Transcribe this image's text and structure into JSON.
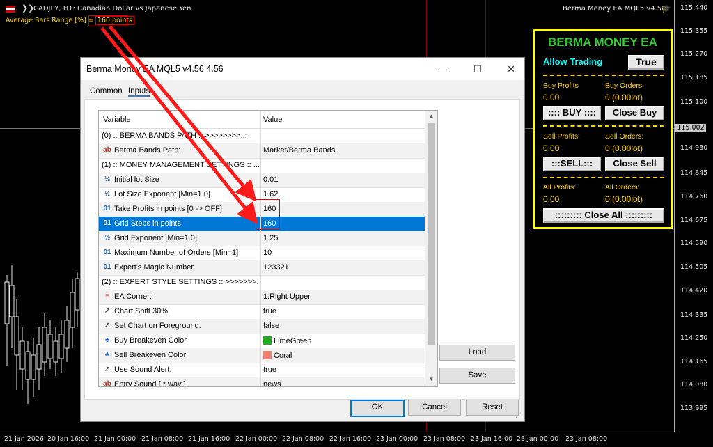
{
  "chart": {
    "symbol_title": "CADJPY, H1:  Canadian Dollar vs Japanese Yen",
    "avg_label": "Average Bars Range [%] =",
    "avg_value": "160 points",
    "ea_label": "Berma Money EA MQL5 v4.56",
    "current_price": "115.002",
    "price_labels": [
      "115.440",
      "115.355",
      "115.270",
      "115.185",
      "115.100",
      "114.930",
      "114.845",
      "114.760",
      "114.675",
      "114.590",
      "114.505",
      "114.420",
      "114.335",
      "114.250",
      "114.165",
      "114.080",
      "113.995"
    ],
    "time_labels": [
      "21 Jan 2026",
      "20 Jan 16:00",
      "21 Jan 00:00",
      "21 Jan 08:00",
      "21 Jan 16:00",
      "22 Jan 00:00",
      "22 Jan 08:00",
      "22 Jan 16:00",
      "23 Jan 00:00",
      "23 Jan 08:00",
      "23 Jan 16:00",
      "23 Jan 00:00",
      "23 Jan 08:00"
    ]
  },
  "panel": {
    "title": "BERMA MONEY EA",
    "allow_label": "Allow Trading",
    "allow_value": "True",
    "buy_profits_label": "Buy Profits",
    "buy_profits_value": "0.00",
    "buy_orders_label": "Buy Orders:",
    "buy_orders_value": "0 (0.00lot)",
    "buy_btn": ":::: BUY ::::",
    "close_buy_btn": "Close Buy",
    "sell_profits_label": "Sell Profits:",
    "sell_profits_value": "0.00",
    "sell_orders_label": "Sell Orders:",
    "sell_orders_value": "0 (0.00lot)",
    "sell_btn": ":::SELL:::",
    "close_sell_btn": "Close Sell",
    "all_profits_label": "All Profits:",
    "all_profits_value": "0.00",
    "all_orders_label": "All Orders:",
    "all_orders_value": "0 (0.00lot)",
    "close_all_btn": "::::::::: Close All :::::::::"
  },
  "dialog": {
    "title": "Berma Money EA MQL5 v4.56 4.56",
    "minimize": "—",
    "maximize": "☐",
    "close": "✕",
    "tabs": [
      "Common",
      "Inputs"
    ],
    "col_variable": "Variable",
    "col_value": "Value",
    "rows": [
      {
        "icon": "",
        "name": "(0) :: BERMA BANDS PATH :: >>>>>>>>...",
        "value": ""
      },
      {
        "icon": "ab",
        "name": "Berma Bands Path:",
        "value": "Market/Berma Bands"
      },
      {
        "icon": "",
        "name": "(1) :: MONEY MANAGEMENT SETTINGS :: ...",
        "value": ""
      },
      {
        "icon": "½",
        "name": "Initial lot Size",
        "value": "0.01"
      },
      {
        "icon": "½",
        "name": "Lot Size Exponent [Min=1.0]",
        "value": "1.62"
      },
      {
        "icon": "01",
        "name": "Take Profits in points [0 -> OFF]",
        "value": "160"
      },
      {
        "icon": "01",
        "name": "Grid Steps in points",
        "value": "160"
      },
      {
        "icon": "½",
        "name": "Grid Exponent [Min=1.0]",
        "value": "1.25"
      },
      {
        "icon": "01",
        "name": "Maximum Number of Orders [Min=1]",
        "value": "10"
      },
      {
        "icon": "01",
        "name": "Expert's Magic Number",
        "value": "123321"
      },
      {
        "icon": "",
        "name": "(2) :: EXPERT STYLE SETTINGS :: >>>>>>>...",
        "value": ""
      },
      {
        "icon": "≡",
        "name": "EA Corner:",
        "value": "1.Right Upper"
      },
      {
        "icon": "↗",
        "name": "Chart Shift 30%",
        "value": "true"
      },
      {
        "icon": "↗",
        "name": "Set Chart on Foreground:",
        "value": "false"
      },
      {
        "icon": "♣",
        "name": "Buy Breakeven Color",
        "value": "LimeGreen"
      },
      {
        "icon": "♣",
        "name": "Sell Breakeven Color",
        "value": "Coral"
      },
      {
        "icon": "↗",
        "name": "Use Sound Alert:",
        "value": "true"
      },
      {
        "icon": "ab",
        "name": "Entry Sound [ *.wav ]",
        "value": "news"
      }
    ],
    "colors": {
      "buy_breakeven": "#22aa22",
      "sell_breakeven": "#f08070",
      "accent": "#0078d7"
    },
    "load_btn": "Load",
    "save_btn": "Save",
    "ok_btn": "OK",
    "cancel_btn": "Cancel",
    "reset_btn": "Reset"
  }
}
